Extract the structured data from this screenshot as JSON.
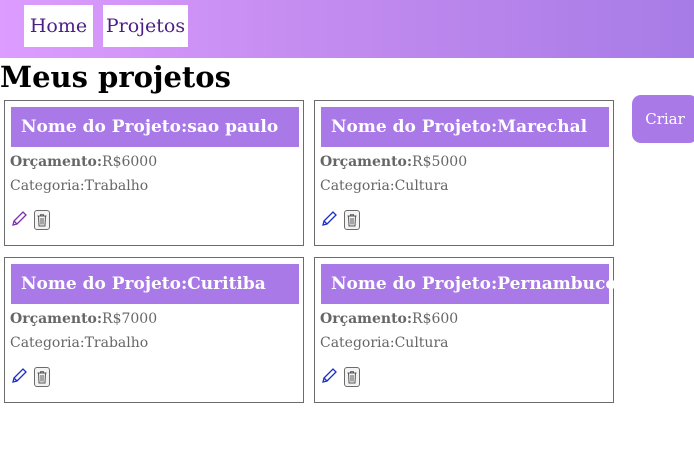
{
  "nav": {
    "home_label": "Home",
    "projects_label": "Projetos"
  },
  "page": {
    "title": "Meus projetos"
  },
  "create_button": {
    "label": "Criar"
  },
  "labels": {
    "project_name": "Nome do Projeto:",
    "budget": "Orçamento:",
    "category": "Categoria:"
  },
  "projects": [
    {
      "name": "sao paulo",
      "budget": "R$6000",
      "category": "Trabalho"
    },
    {
      "name": "Marechal",
      "budget": "R$5000",
      "category": "Cultura"
    },
    {
      "name": "Curitiba",
      "budget": "R$7000",
      "category": "Trabalho"
    },
    {
      "name": "Pernambuco",
      "budget": "R$600",
      "category": "Cultura"
    }
  ],
  "icons": {
    "edit": "pencil-icon",
    "delete": "trash-icon"
  },
  "colors": {
    "accent": "#a97ae7",
    "nav_gradient_start": "#dd9cff",
    "nav_gradient_end": "#a77be6"
  }
}
